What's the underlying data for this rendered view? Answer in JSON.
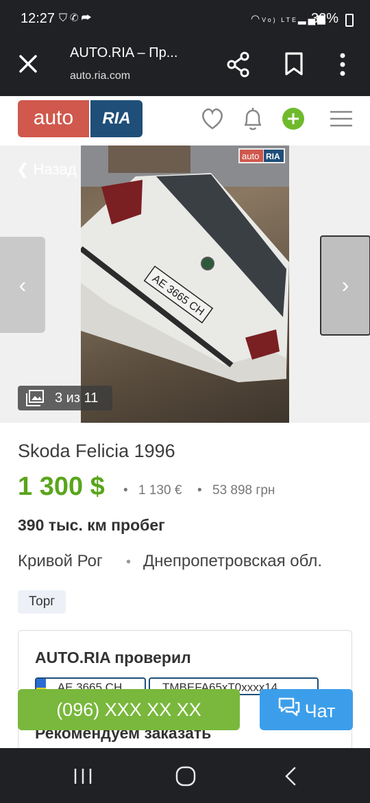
{
  "status_bar": {
    "time": "12:27",
    "battery": "32%",
    "network": "Vo) LTE"
  },
  "browser": {
    "page_title": "AUTO.RIA – Пр...",
    "url": "auto.ria.com",
    "icons": [
      "close-icon",
      "share-icon",
      "bookmark-icon",
      "more-vert-icon"
    ]
  },
  "header": {
    "logo_auto": "auto",
    "logo_ria": "RIA",
    "icons": [
      "heart-icon",
      "bell-icon",
      "add-circle-icon",
      "menu-icon"
    ],
    "accent": "#d0584d",
    "brand_blue": "#1f4e79",
    "add_green": "#6fba2c"
  },
  "gallery": {
    "back_label": "Назад",
    "counter": "3 из 11",
    "watermark_auto": "auto",
    "watermark_ria": "RIA",
    "plate": "AE 3665 CH"
  },
  "listing": {
    "title": "Skoda Felicia 1996",
    "price_usd": "1 300 $",
    "price_eur": "1 130 €",
    "price_uah": "53 898 грн",
    "mileage": "390 тыс. км пробег",
    "city": "Кривой Рог",
    "region": "Днепропетровская обл.",
    "badge": "Торг",
    "price_color": "#5aa51c"
  },
  "check_card": {
    "heading": "AUTO.RIA проверил",
    "plate_chip": "AE 3665 CH",
    "vin_chip": "TMBEFA65xT0xxxx14",
    "recommend": "Рекомендуем заказать"
  },
  "actions": {
    "phone": "(096) XXX XX XX",
    "chat": "Чат",
    "phone_color": "#79b83c",
    "chat_color": "#3c9eea"
  }
}
